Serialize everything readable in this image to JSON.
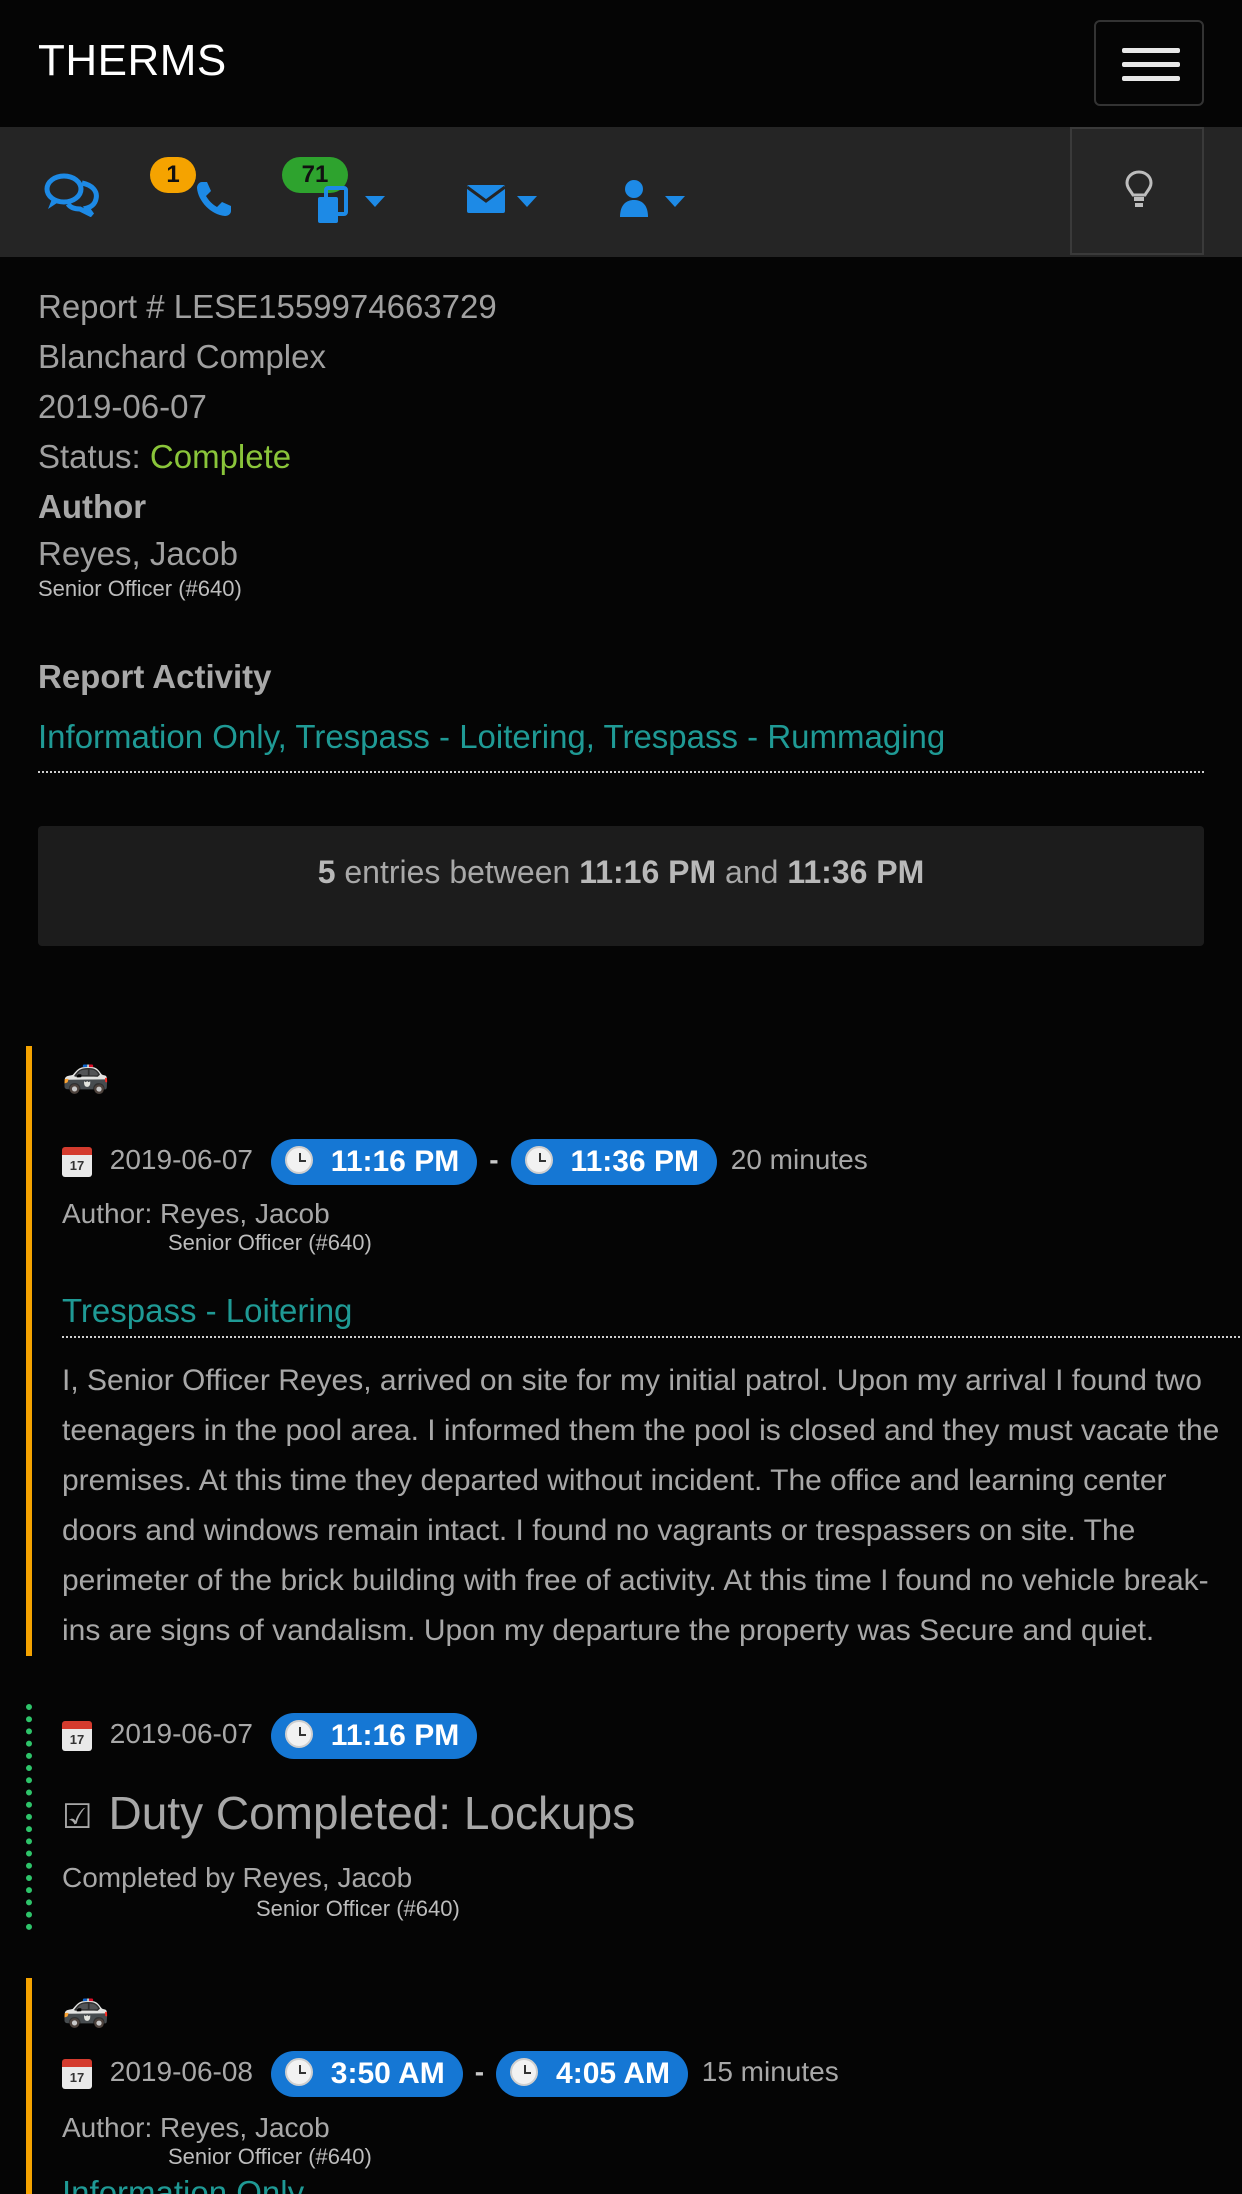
{
  "app": {
    "title": "THERMS"
  },
  "toolbar": {
    "items": [
      {
        "icon": "chat-bubbles-icon"
      },
      {
        "icon": "phone-icon",
        "badge": "1"
      },
      {
        "icon": "documents-icon",
        "badge": "71"
      },
      {
        "icon": "envelope-icon"
      },
      {
        "icon": "user-icon"
      },
      {
        "icon": "lightbulb-icon"
      }
    ]
  },
  "report": {
    "number": "Report # LESE1559974663729",
    "site": "Blanchard Complex",
    "date": "2019-06-07",
    "status_label": "Status:",
    "status_value": "Complete",
    "author_heading": "Author",
    "author_name": "Reyes, Jacob",
    "author_rank": "Senior Officer (#640)",
    "activity_heading": "Report Activity",
    "activity_list": "Information Only, Trespass - Loitering, Trespass - Rummaging"
  },
  "summary": {
    "count": "5",
    "text_between": "entries between",
    "start": "11:16 PM",
    "and": "and",
    "end": "11:36 PM"
  },
  "entries": [
    {
      "kind": "patrol",
      "date": "2019-06-07",
      "start": "11:16 PM",
      "end": "11:36 PM",
      "duration": "20 minutes",
      "author": "Author: Reyes, Jacob",
      "rank": "Senior Officer (#640)",
      "type": "Trespass - Loitering",
      "body": "I, Senior Officer Reyes, arrived on site for my initial patrol. Upon my arrival I found two teenagers in the pool area. I informed them the pool is  closed and they must vacate the premises. At this time they departed without incident. The office and learning center doors and windows remain intact. I found no vagrants or trespassers on site. The perimeter of the brick building with free of activity. At this time I found no vehicle break-ins are signs of vandalism. Upon my departure the property was Secure and quiet."
    },
    {
      "kind": "duty",
      "date": "2019-06-07",
      "start": "11:16 PM",
      "title": "Duty Completed: Lockups",
      "completed_by": "Completed by Reyes, Jacob",
      "rank": "Senior Officer (#640)"
    },
    {
      "kind": "patrol",
      "date": "2019-06-08",
      "start": "3:50 AM",
      "end": "4:05 AM",
      "duration": "15 minutes",
      "author": "Author: Reyes, Jacob",
      "rank": "Senior Officer (#640)",
      "type": "Information Only"
    }
  ],
  "calendar_icon_text": "17",
  "time_separator": "-",
  "colors": {
    "accent_blue": "#1577d4",
    "status_green": "#8ac53a",
    "activity_teal": "#1f9a95",
    "patrol_border": "#f5a300",
    "duty_border": "#2ec46a",
    "badge_orange": "#f5a300",
    "badge_green": "#2ea32e"
  }
}
